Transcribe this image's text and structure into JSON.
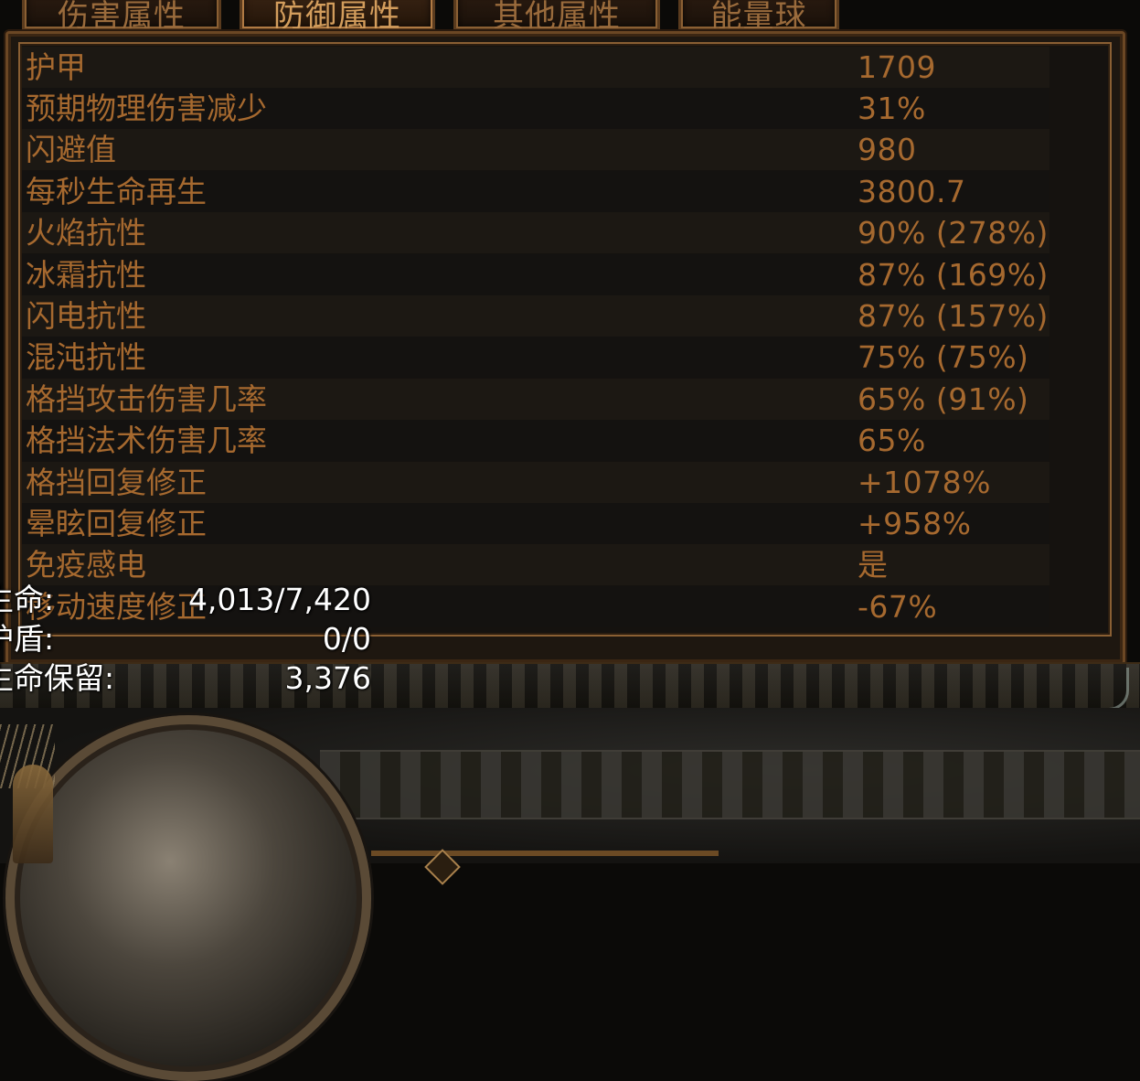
{
  "tabs": [
    {
      "label": "伤害属性",
      "active": false
    },
    {
      "label": "防御属性",
      "active": true
    },
    {
      "label": "其他属性",
      "active": false
    },
    {
      "label": "能量球",
      "active": false
    }
  ],
  "defense_stats": [
    {
      "label": "护甲",
      "value": "1709"
    },
    {
      "label": "预期物理伤害减少",
      "value": "31%"
    },
    {
      "label": "闪避值",
      "value": "980"
    },
    {
      "label": "每秒生命再生",
      "value": "3800.7"
    },
    {
      "label": "火焰抗性",
      "value": "90% (278%)"
    },
    {
      "label": "冰霜抗性",
      "value": "87% (169%)"
    },
    {
      "label": "闪电抗性",
      "value": "87% (157%)"
    },
    {
      "label": "混沌抗性",
      "value": "75% (75%)"
    },
    {
      "label": "格挡攻击伤害几率",
      "value": "65% (91%)"
    },
    {
      "label": "格挡法术伤害几率",
      "value": "65%"
    },
    {
      "label": "格挡回复修正",
      "value": "+1078%"
    },
    {
      "label": "晕眩回复修正",
      "value": "+958%"
    },
    {
      "label": "免疫感电",
      "value": "是"
    },
    {
      "label": "移动速度修正",
      "value": "-67%"
    }
  ],
  "life_overlay": {
    "life_label": "生命:",
    "life_value": "4,013/7,420",
    "shield_label": "护盾:",
    "shield_value": "0/0",
    "reserved_label": "生命保留:",
    "reserved_value": "3,376"
  },
  "colors": {
    "stat_text": "#a6692f",
    "tab_active": "#d39d5c",
    "frame": "#8a5f33",
    "overlay_text": "#ffffff"
  }
}
